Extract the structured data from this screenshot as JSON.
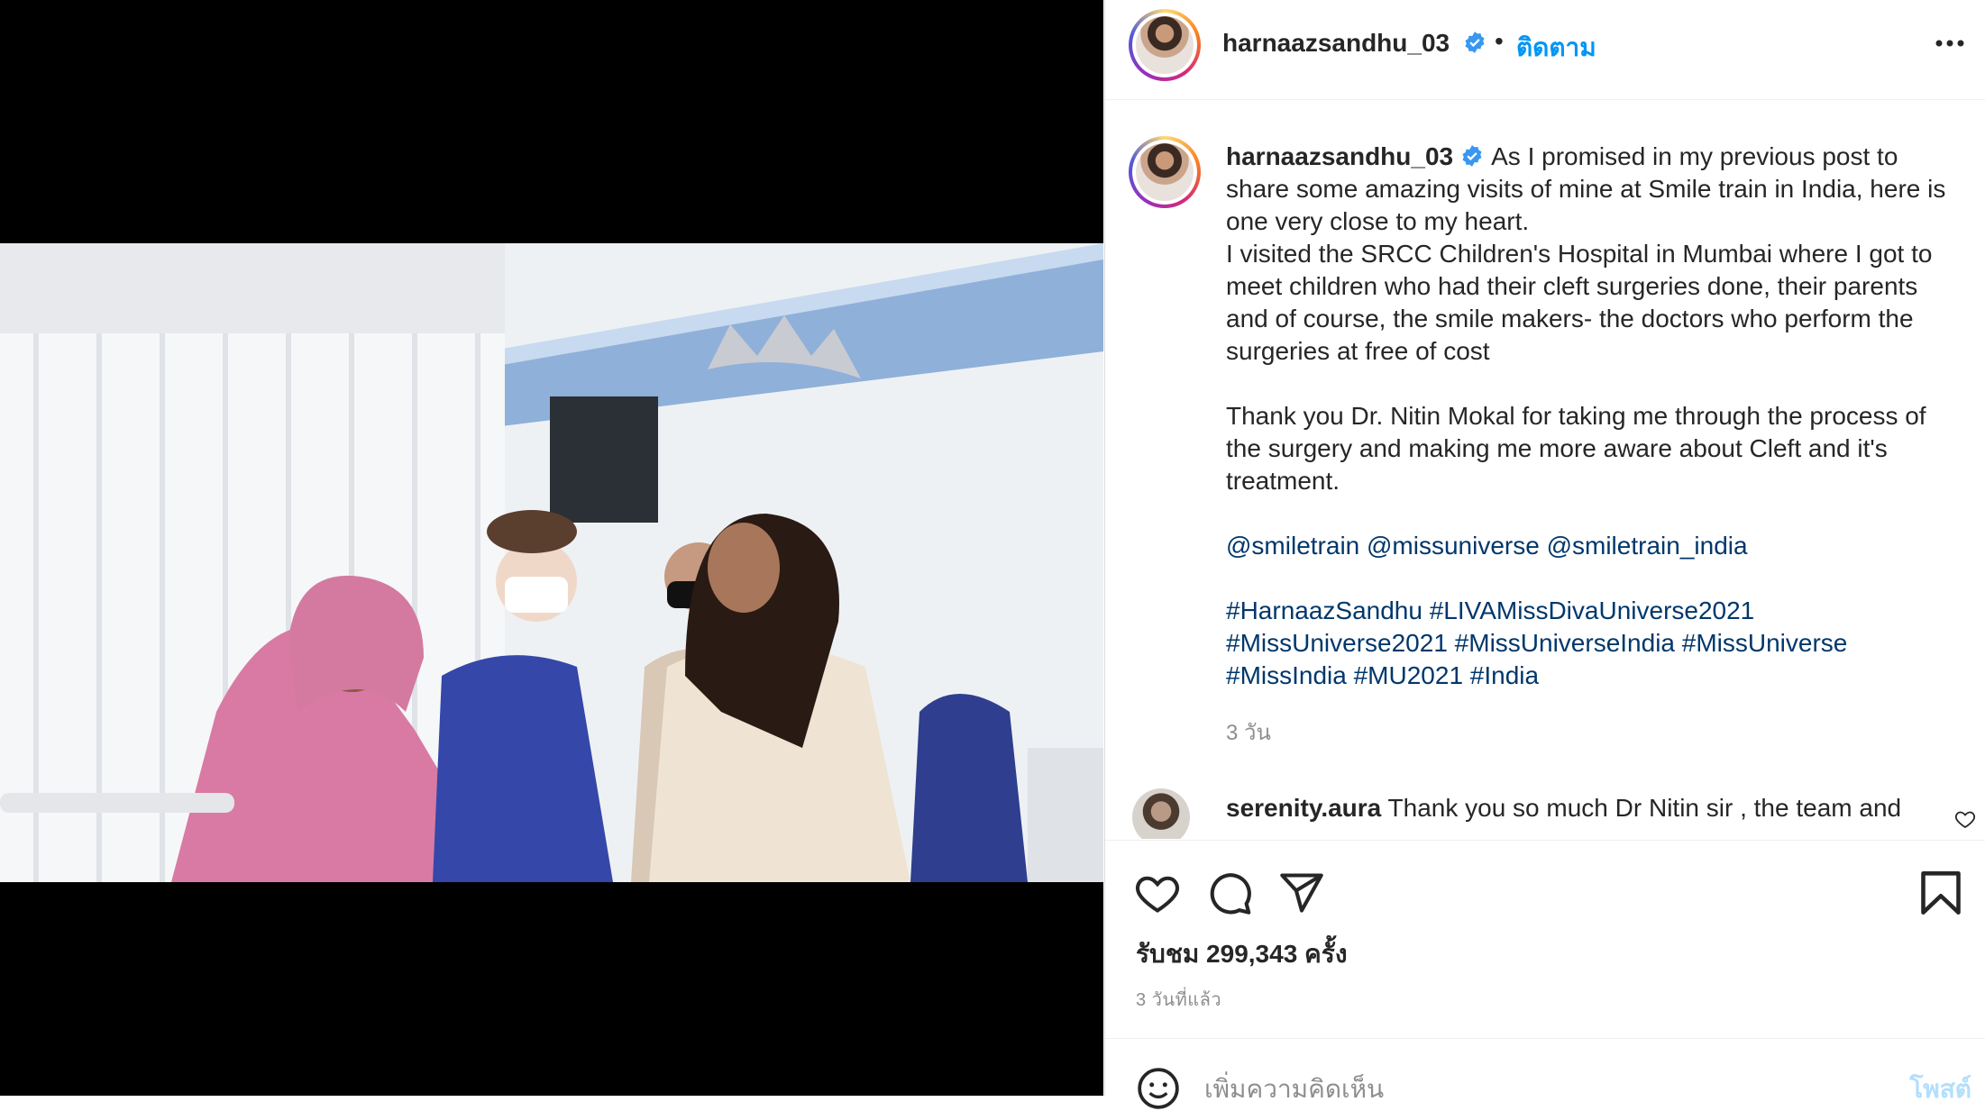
{
  "post": {
    "username": "harnaazsandhu_03",
    "separator": "•",
    "follow_label": "ติดตาม",
    "caption_body": "As I promised in my previous post to share some amazing visits of mine at Smile train in India, here is one very close to my heart.\nI visited the SRCC Children's Hospital in Mumbai where I got to meet children who had their cleft surgeries done, their parents and of course, the smile makers- the doctors who perform the surgeries at free of cost\n\nThank you Dr. Nitin Mokal for taking me through the process of the surgery and making me more aware about Cleft and it's treatment.\n\n",
    "mentions": "@smiletrain @missuniverse @smiletrain_india",
    "hashtags": "#HarnaazSandhu #LIVAMissDivaUniverse2021 #MissUniverse2021 #MissUniverseIndia #MissUniverse #MissIndia #MU2021 #India",
    "caption_time": "3 วัน",
    "views_label": "รับชม 299,343 ครั้ง",
    "posted_ago": "3 วันที่แล้ว"
  },
  "comment": {
    "username": "serenity.aura",
    "text": "Thank you so much Dr Nitin sir , the team and"
  },
  "add_comment": {
    "placeholder": "เพิ่มความคิดเห็น",
    "post_label": "โพสต์"
  },
  "icons": {
    "verified": "verified-badge-icon",
    "more": "more-options-icon",
    "like": "heart-icon",
    "comment": "comment-bubble-icon",
    "share": "paper-plane-icon",
    "save": "bookmark-icon",
    "emoji": "emoji-icon"
  },
  "colors": {
    "accent": "#0095f6",
    "link": "#00376b",
    "muted": "#8e8e8e",
    "verified": "#3897f0"
  }
}
